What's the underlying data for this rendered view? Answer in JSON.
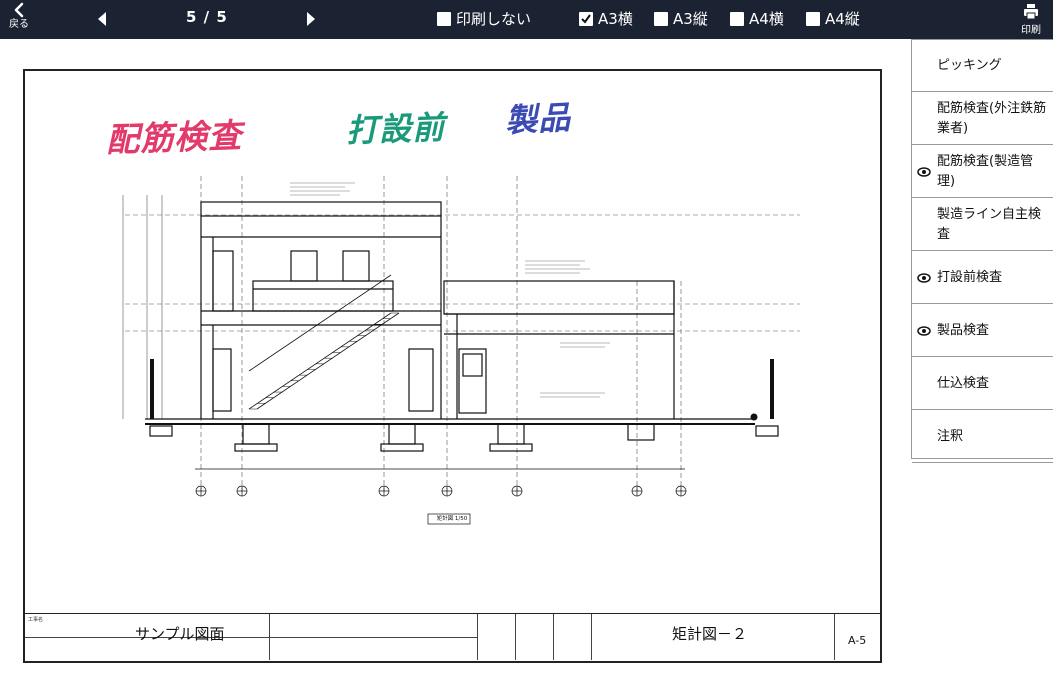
{
  "toolbar": {
    "back_label": "戻る",
    "page_indicator": "5 / 5",
    "options": [
      {
        "label": "印刷しない",
        "checked": false
      },
      {
        "label": "A3横",
        "checked": true
      },
      {
        "label": "A3縦",
        "checked": false
      },
      {
        "label": "A4横",
        "checked": false
      },
      {
        "label": "A4縦",
        "checked": false
      }
    ],
    "print_label": "印刷"
  },
  "document": {
    "annotations": [
      {
        "text": "配筋検査",
        "color": "#e23a6a"
      },
      {
        "text": "打設前",
        "color": "#1a9a7a"
      },
      {
        "text": "製品",
        "color": "#3c4ab3"
      }
    ],
    "caption": "矩計図 1/50",
    "title_block": {
      "project_name": "サンプル図面",
      "drawing_name": "矩計図－２",
      "drawing_number": "A-5"
    }
  },
  "side_panel": {
    "items": [
      {
        "label": "ピッキング",
        "visible_icon": false
      },
      {
        "label": "配筋検査(外注鉄筋業者)",
        "visible_icon": false
      },
      {
        "label": "配筋検査(製造管理)",
        "visible_icon": true
      },
      {
        "label": "製造ライン自主検査",
        "visible_icon": false
      },
      {
        "label": "打設前検査",
        "visible_icon": true
      },
      {
        "label": "製品検査",
        "visible_icon": true
      },
      {
        "label": "仕込検査",
        "visible_icon": false
      },
      {
        "label": "注釈",
        "visible_icon": false
      }
    ]
  }
}
